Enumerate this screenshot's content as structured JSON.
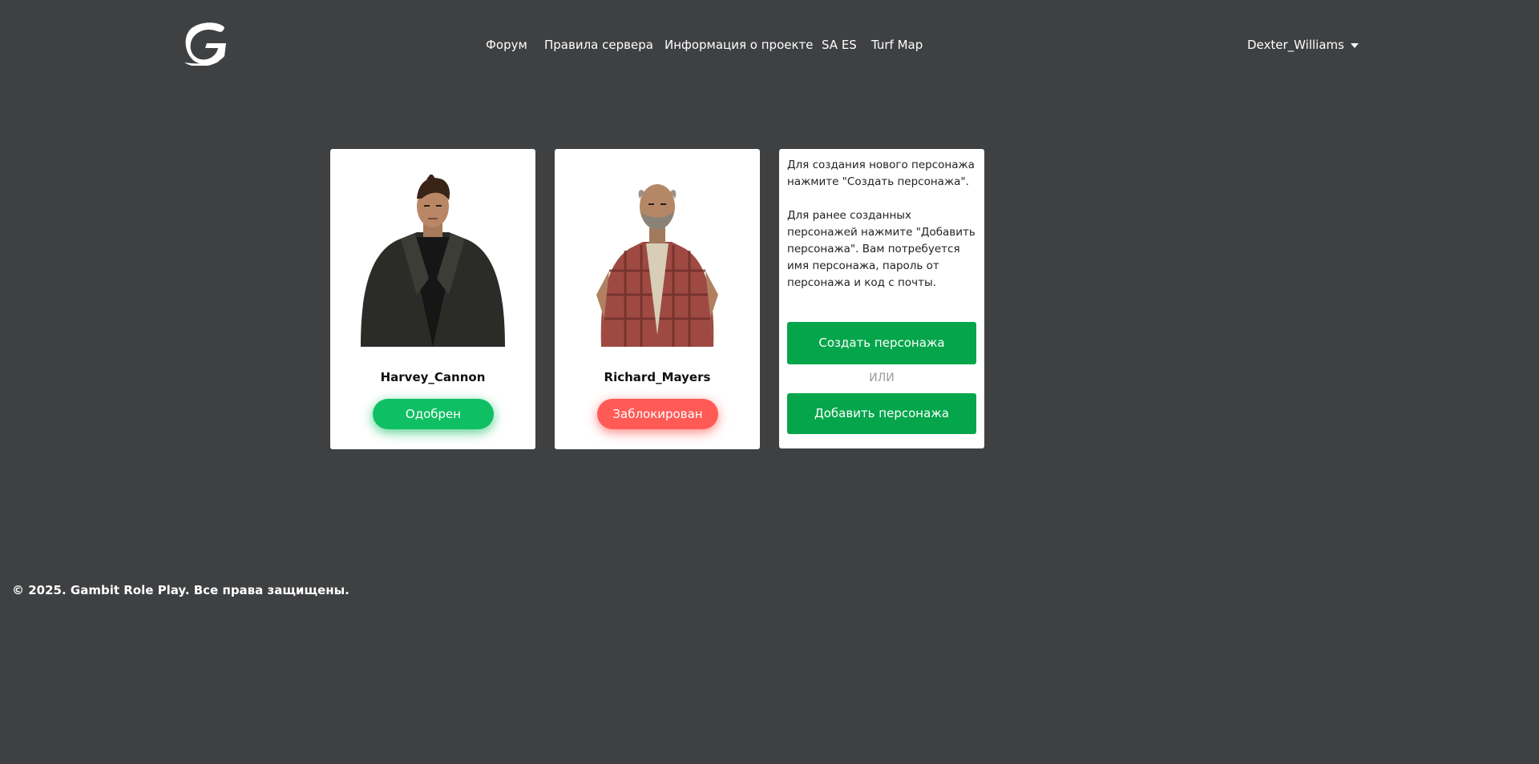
{
  "header": {
    "logo_icon": "gambit-g-logo-icon",
    "nav": [
      {
        "label": "Форум"
      },
      {
        "label": "Правила сервера"
      },
      {
        "label": "Информация о проекте"
      },
      {
        "label": "SA ES"
      },
      {
        "label": "Turf Map"
      }
    ],
    "user": {
      "name": "Dexter_Williams",
      "caret_icon": "caret-down-icon"
    }
  },
  "characters": [
    {
      "name": "Harvey_Cannon",
      "status": "Одобрен",
      "status_color": "#0fbf63"
    },
    {
      "name": "Richard_Mayers",
      "status": "Заблокирован",
      "status_color": "#ff5a55"
    }
  ],
  "info": {
    "text": "Для создания нового персонажа нажмите \"Создать персонажа\".\n\nДля ранее созданных персонажей нажмите \"Добавить персонажа\". Вам потребуется имя персонажа, пароль от персонажа и код с почты.",
    "create_label": "Создать персонажа",
    "or_label": "ИЛИ",
    "add_label": "Добавить персонажа",
    "button_color": "#05a64b"
  },
  "footer": {
    "copyright": "© 2025. Gambit Role Play. Все права защищены."
  }
}
